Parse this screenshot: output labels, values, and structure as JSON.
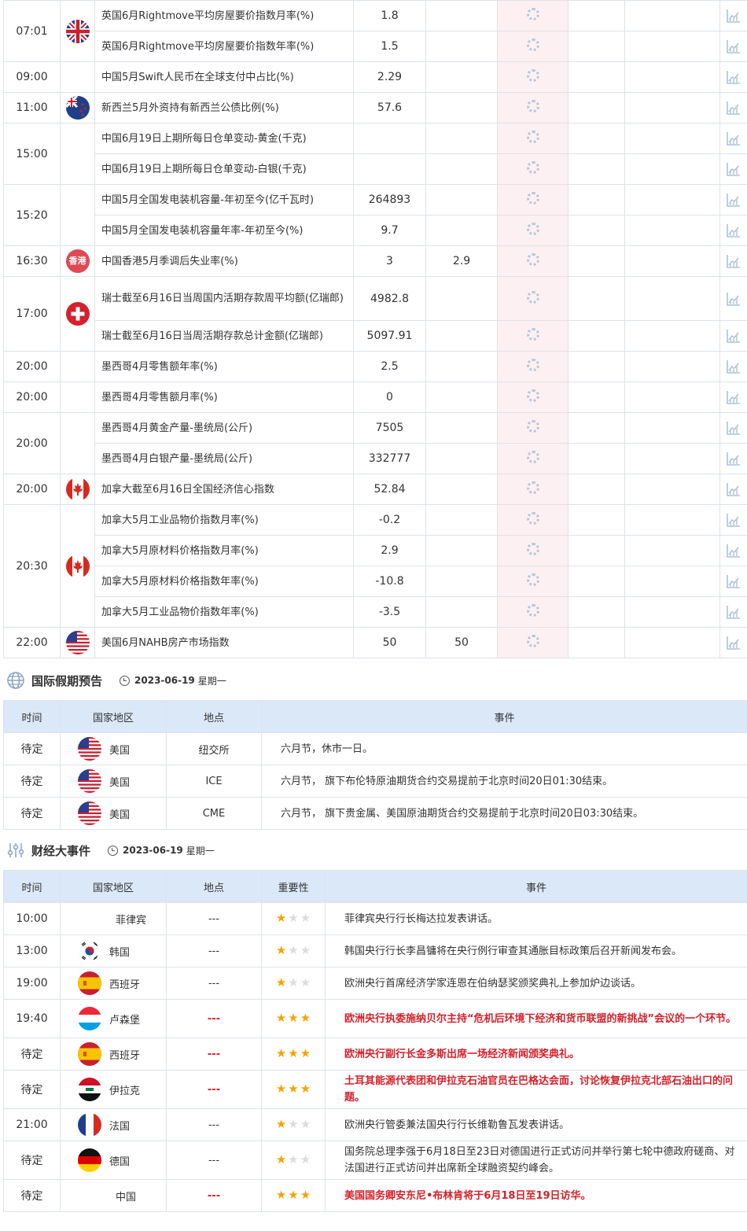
{
  "data_rows": [
    {
      "time": "07:01",
      "flag": "uk",
      "items": [
        {
          "name": "英国6月Rightmove平均房屋要价指数月率(%)",
          "prev": "1.8",
          "forecast": ""
        },
        {
          "name": "英国6月Rightmove平均房屋要价指数年率(%)",
          "prev": "1.5",
          "forecast": ""
        }
      ]
    },
    {
      "time": "09:00",
      "flag": "",
      "items": [
        {
          "name": "中国5月Swift人民币在全球支付中占比(%)",
          "prev": "2.29",
          "forecast": ""
        }
      ]
    },
    {
      "time": "11:00",
      "flag": "nz",
      "items": [
        {
          "name": "新西兰5月外资持有新西兰公债比例(%)",
          "prev": "57.6",
          "forecast": ""
        }
      ]
    },
    {
      "time": "15:00",
      "flag": "",
      "items": [
        {
          "name": "中国6月19日上期所每日仓单变动-黄金(千克)",
          "prev": "",
          "forecast": ""
        },
        {
          "name": "中国6月19日上期所每日仓单变动-白银(千克)",
          "prev": "",
          "forecast": ""
        }
      ]
    },
    {
      "time": "15:20",
      "flag": "",
      "items": [
        {
          "name": "中国5月全国发电装机容量-年初至今(亿千瓦时)",
          "prev": "264893",
          "forecast": ""
        },
        {
          "name": "中国5月全国发电装机容量年率-年初至今(%)",
          "prev": "9.7",
          "forecast": ""
        }
      ]
    },
    {
      "time": "16:30",
      "flag": "hk",
      "items": [
        {
          "name": "中国香港5月季调后失业率(%)",
          "prev": "3",
          "forecast": "2.9"
        }
      ]
    },
    {
      "time": "17:00",
      "flag": "ch",
      "items": [
        {
          "name": "瑞士截至6月16日当周国内活期存款周平均额(亿瑞郎)",
          "prev": "4982.8",
          "forecast": "",
          "tall": true
        },
        {
          "name": "瑞士截至6月16日当周活期存款总计金额(亿瑞郎)",
          "prev": "5097.91",
          "forecast": ""
        }
      ]
    },
    {
      "time": "20:00",
      "flag": "",
      "items": [
        {
          "name": "墨西哥4月零售额年率(%)",
          "prev": "2.5",
          "forecast": ""
        }
      ]
    },
    {
      "time": "20:00",
      "flag": "",
      "items": [
        {
          "name": "墨西哥4月零售额月率(%)",
          "prev": "0",
          "forecast": ""
        }
      ]
    },
    {
      "time": "20:00",
      "flag": "",
      "items": [
        {
          "name": "墨西哥4月黄金产量-墨统局(公斤)",
          "prev": "7505",
          "forecast": ""
        },
        {
          "name": "墨西哥4月白银产量-墨统局(公斤)",
          "prev": "332777",
          "forecast": ""
        }
      ]
    },
    {
      "time": "20:00",
      "flag": "ca",
      "items": [
        {
          "name": "加拿大截至6月16日全国经济信心指数",
          "prev": "52.84",
          "forecast": ""
        }
      ]
    },
    {
      "time": "20:30",
      "flag": "ca",
      "items": [
        {
          "name": "加拿大5月工业品物价指数月率(%)",
          "prev": "-0.2",
          "forecast": ""
        },
        {
          "name": "加拿大5月原材料价格指数月率(%)",
          "prev": "2.9",
          "forecast": ""
        },
        {
          "name": "加拿大5月原材料价格指数年率(%)",
          "prev": "-10.8",
          "forecast": ""
        },
        {
          "name": "加拿大5月工业品物价指数年率(%)",
          "prev": "-3.5",
          "forecast": ""
        }
      ]
    },
    {
      "time": "22:00",
      "flag": "us",
      "items": [
        {
          "name": "美国6月NAHB房产市场指数",
          "prev": "50",
          "forecast": "50"
        }
      ]
    }
  ],
  "holiday": {
    "title": "国际假期预告",
    "date": "2023-06-19",
    "weekday": "星期一",
    "headers": [
      "时间",
      "国家地区",
      "地点",
      "事件"
    ],
    "rows": [
      {
        "time": "待定",
        "flag": "us",
        "country": "美国",
        "place": "纽交所",
        "event": "六月节，休市一日。"
      },
      {
        "time": "待定",
        "flag": "us",
        "country": "美国",
        "place": "ICE",
        "event": "六月节， 旗下布伦特原油期货合约交易提前于北京时间20日01:30结束。"
      },
      {
        "time": "待定",
        "flag": "us",
        "country": "美国",
        "place": "CME",
        "event": "六月节， 旗下贵金属、美国原油期货合约交易提前于北京时间20日03:30结束。"
      }
    ]
  },
  "events": {
    "title": "财经大事件",
    "date": "2023-06-19",
    "weekday": "星期一",
    "headers": [
      "时间",
      "国家地区",
      "地点",
      "重要性",
      "事件"
    ],
    "rows": [
      {
        "time": "10:00",
        "flag": "",
        "country": "菲律宾",
        "place": "---",
        "stars": 1,
        "hot": false,
        "event": "菲律宾央行行长梅达拉发表讲话。"
      },
      {
        "time": "13:00",
        "flag": "kr",
        "country": "韩国",
        "place": "---",
        "stars": 1,
        "hot": false,
        "event": "韩国央行行长李昌镛将在央行例行审查其通胀目标政策后召开新闻发布会。"
      },
      {
        "time": "19:00",
        "flag": "es",
        "country": "西班牙",
        "place": "---",
        "stars": 1,
        "hot": false,
        "event": "欧洲央行首席经济学家连恩在伯纳瑟奖颁奖典礼上参加炉边谈话。"
      },
      {
        "time": "19:40",
        "flag": "lu",
        "country": "卢森堡",
        "place": "---",
        "stars": 3,
        "hot": true,
        "event": "欧洲央行执委施纳贝尔主持“危机后环境下经济和货币联盟的新挑战”会议的一个环节。"
      },
      {
        "time": "待定",
        "flag": "es",
        "country": "西班牙",
        "place": "---",
        "stars": 3,
        "hot": true,
        "event": "欧洲央行副行长金多斯出席一场经济新闻颁奖典礼。"
      },
      {
        "time": "待定",
        "flag": "iq",
        "country": "伊拉克",
        "place": "---",
        "stars": 3,
        "hot": true,
        "event": "土耳其能源代表团和伊拉克石油官员在巴格达会面，讨论恢复伊拉克北部石油出口的问题。"
      },
      {
        "time": "21:00",
        "flag": "fr",
        "country": "法国",
        "place": "---",
        "stars": 1,
        "hot": false,
        "event": "欧洲央行管委兼法国央行行长维勒鲁瓦发表讲话。"
      },
      {
        "time": "待定",
        "flag": "de",
        "country": "德国",
        "place": "---",
        "stars": 1,
        "hot": false,
        "event": "国务院总理李强于6月18日至23日对德国进行正式访问并举行第七轮中德政府磋商、对法国进行正式访问并出席新全球融资契约峰会。"
      },
      {
        "time": "待定",
        "flag": "",
        "country": "中国",
        "place": "---",
        "stars": 3,
        "hot": true,
        "event": "美国国务卿安东尼•布林肯将于6月18日至19日访华。"
      }
    ]
  },
  "colors": {
    "accent": "#dbe8f8",
    "actual_bg": "#fdf0f2",
    "hot_text": "#d5202a",
    "star_on": "#f5a300"
  }
}
